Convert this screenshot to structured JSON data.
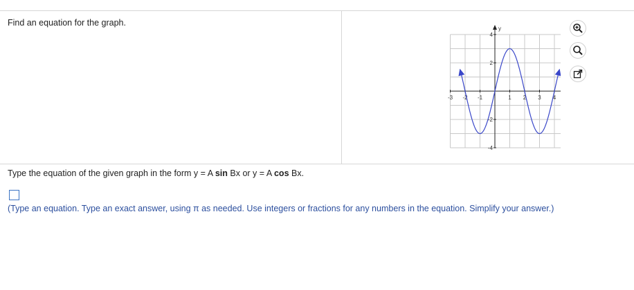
{
  "question": {
    "text": "Find an equation for the graph."
  },
  "instruction": {
    "prefix": "Type the equation of the given graph in the form y = A ",
    "sin_word": "sin",
    "middle": " Bx or y = A ",
    "cos_word": "cos",
    "suffix": " Bx."
  },
  "answer": {
    "value": ""
  },
  "hint": {
    "text": "(Type an equation. Type an exact answer, using π as needed. Use integers or fractions for any numbers in the equation. Simplify your answer.)"
  },
  "tools": {
    "zoom_in_icon": "zoom-in-icon",
    "zoom_out_icon": "zoom-out-icon",
    "popout_icon": "popout-icon",
    "icon_color": "#1a1a1a"
  },
  "chart_data": {
    "type": "line",
    "xlabel": "x",
    "ylabel": "y",
    "xlim": [
      -3,
      5
    ],
    "ylim": [
      -4,
      4
    ],
    "grid": true,
    "x_ticks": [
      "-3",
      "-2",
      "-1",
      "1",
      "2",
      "3",
      "4",
      "5"
    ],
    "y_ticks": [
      "4",
      "2",
      "-2",
      "-4"
    ],
    "series": [
      {
        "color": "#3a47c9",
        "function": "y = 3 sin((π/2) x)",
        "x_range": [
          -2.32,
          4.32
        ],
        "arrows": "both ends",
        "key_points": [
          [
            -1,
            -3
          ],
          [
            0,
            0
          ],
          [
            1,
            3
          ],
          [
            2,
            0
          ],
          [
            3,
            -3
          ],
          [
            4,
            0
          ]
        ]
      }
    ]
  }
}
